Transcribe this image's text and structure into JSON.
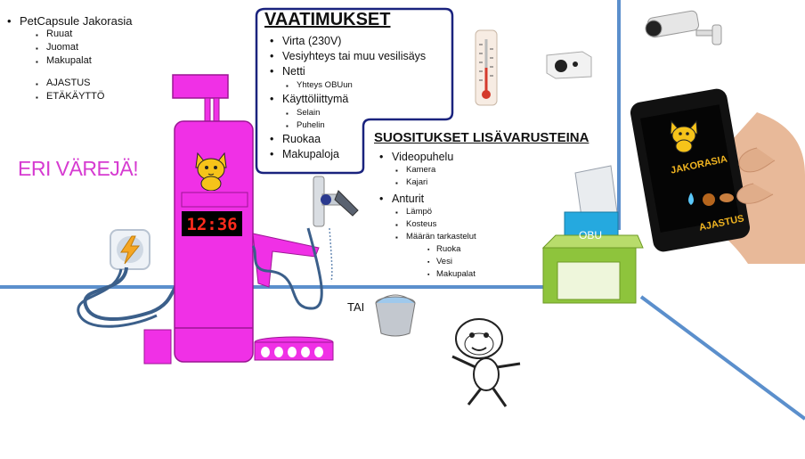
{
  "left_list": {
    "title": "PetCapsule Jakorasia",
    "items": [
      "Ruuat",
      "Juomat",
      "Makupalat"
    ],
    "features": [
      "AJASTUS",
      "ETÄKÄYTTÖ"
    ]
  },
  "colors_note": "ERI VÄREJÄ!",
  "requirements": {
    "title": "VAATIMUKSET",
    "power": "Virta (230V)",
    "water": "Vesiyhteys tai muu vesilisäys",
    "net": "Netti",
    "net_sub": "Yhteys OBUun",
    "ui": "Käyttöliittymä",
    "ui_subs": [
      "Selain",
      "Puhelin"
    ],
    "food": "Ruokaa",
    "treats": "Makupaloja"
  },
  "optional": {
    "title": "SUOSITUKSET LISÄVARUSTEINA",
    "video": "Videopuhelu",
    "video_subs": [
      "Kamera",
      "Kajari"
    ],
    "sensors": "Anturit",
    "sensor_subs": [
      "Lämpö",
      "Kosteus",
      "Määrän tarkastelut"
    ],
    "amount_subs": [
      "Ruoka",
      "Vesi",
      "Makupalat"
    ]
  },
  "dispenser": {
    "clock": "12:36"
  },
  "or_label": "TAI",
  "obu_label": "OBU",
  "phone": {
    "line1": "JAKORASIA",
    "line2": "AJASTUS"
  },
  "colors": {
    "dispenser": "#f030e6",
    "wall": "#4a86c8",
    "obu": "#8ec43c",
    "accent": "#d63bd1"
  }
}
